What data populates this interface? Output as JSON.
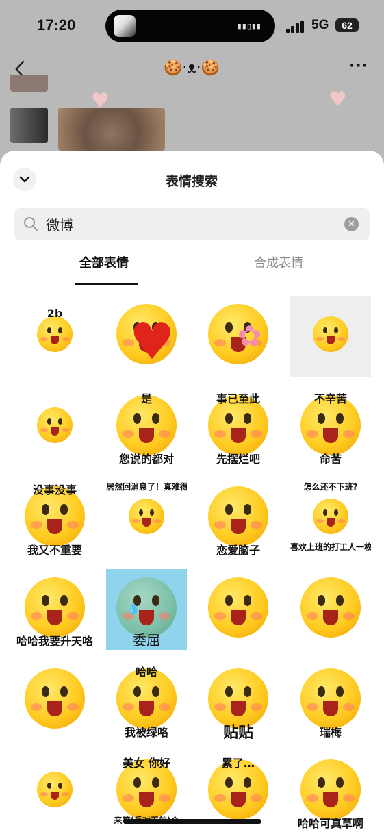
{
  "status_bar": {
    "time": "17:20",
    "network": "5G",
    "battery": "62"
  },
  "chat": {
    "title": "🍪·ᴥ·🍪",
    "more": "···"
  },
  "sheet": {
    "title": "表情搜索",
    "search": {
      "value": "微博",
      "placeholder": ""
    },
    "tabs": [
      {
        "label": "全部表情",
        "active": true
      },
      {
        "label": "合成表情",
        "active": false
      }
    ]
  },
  "stickers": [
    {
      "caption": "2b"
    },
    {
      "caption": ""
    },
    {
      "caption": ""
    },
    {
      "caption": ""
    },
    {
      "caption": ""
    },
    {
      "caption_top": "是",
      "caption": "您说的都对"
    },
    {
      "caption_top": "事已至此",
      "caption": "先摆烂吧"
    },
    {
      "caption_top": "不辛苦",
      "caption": "命苦"
    },
    {
      "caption_top": "没事没事",
      "caption": "我又不重要"
    },
    {
      "caption_top": "居然回消息了！真难得",
      "caption": ""
    },
    {
      "caption": "恋爱脑子"
    },
    {
      "caption_top": "怎么还不下班?",
      "caption": "喜欢上班的打工人一枚吖"
    },
    {
      "caption": "哈哈我要升天咯"
    },
    {
      "caption": "委屈"
    },
    {
      "caption": ""
    },
    {
      "caption": ""
    },
    {
      "caption": ""
    },
    {
      "caption_top": "哈哈",
      "caption": "我被绿咯"
    },
    {
      "caption": "贴贴"
    },
    {
      "caption": "瑞梅"
    },
    {
      "caption": ""
    },
    {
      "caption_top": "美女 你好",
      "caption": "来嘛(反对无效)个"
    },
    {
      "caption_top": "累了…",
      "caption": ""
    },
    {
      "caption": "哈哈可真草啊"
    }
  ],
  "colors": {
    "accent": "#111111",
    "inactive_tab": "#888888",
    "sheet_bg": "#ffffff",
    "overlay": "#b9b9b9"
  }
}
